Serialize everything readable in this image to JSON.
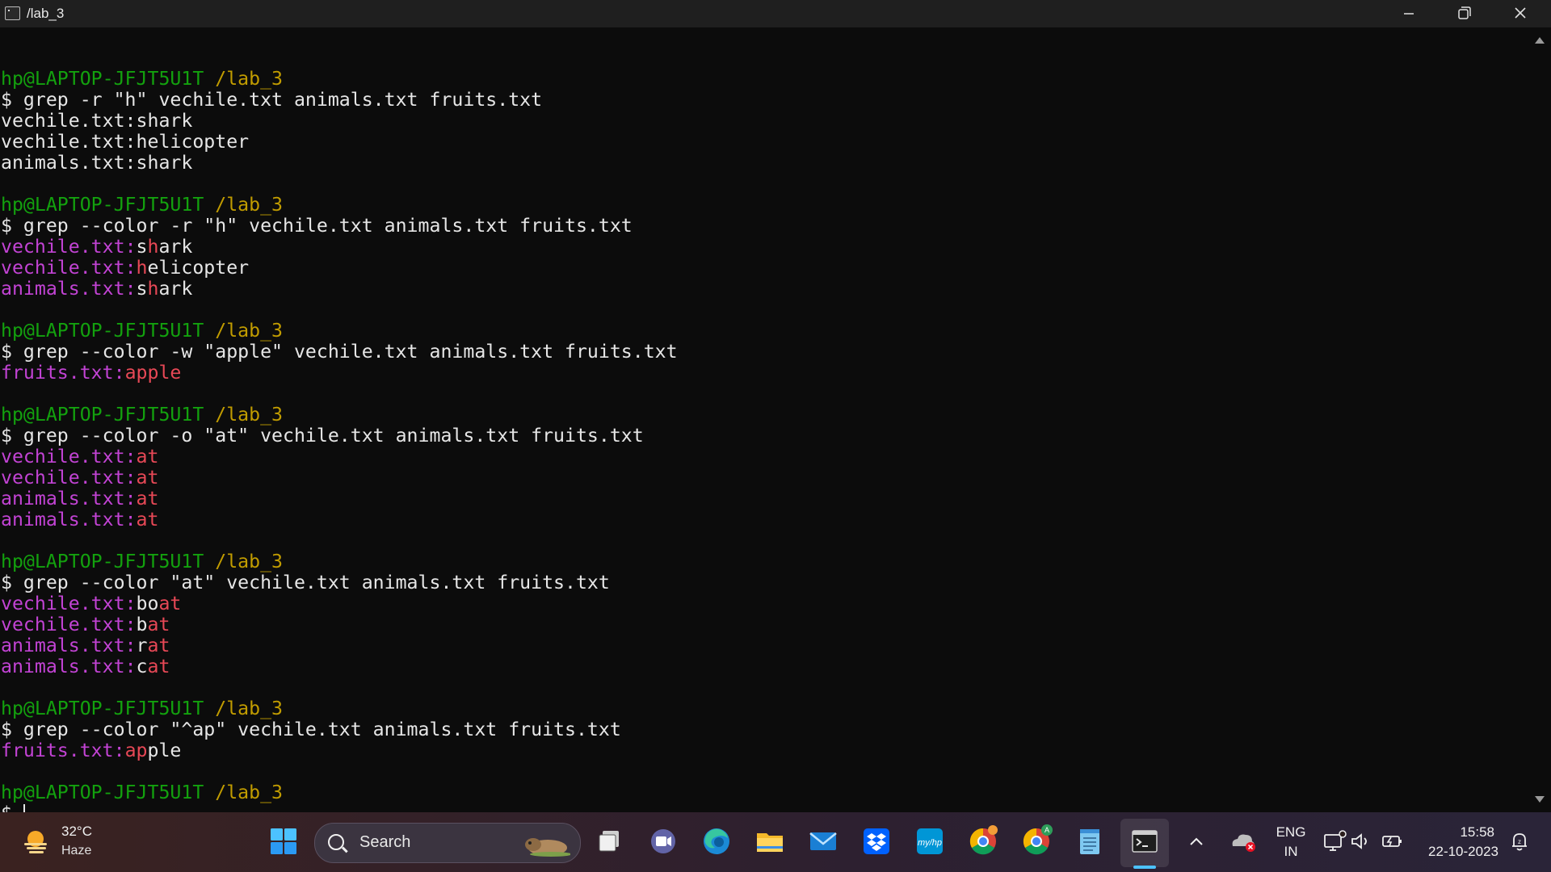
{
  "window": {
    "title": "/lab_3"
  },
  "terminal": {
    "lines": [
      [],
      [
        {
          "t": "hp@LAPTOP-JFJT5U1T",
          "c": "g"
        },
        {
          "t": " ",
          "c": "w"
        },
        {
          "t": "/lab_3",
          "c": "y"
        }
      ],
      [
        {
          "t": "$ grep -r \"h\" vechile.txt animals.txt fruits.txt",
          "c": "w"
        }
      ],
      [
        {
          "t": "vechile.txt:shark",
          "c": "w"
        }
      ],
      [
        {
          "t": "vechile.txt:helicopter",
          "c": "w"
        }
      ],
      [
        {
          "t": "animals.txt:shark",
          "c": "w"
        }
      ],
      [],
      [
        {
          "t": "hp@LAPTOP-JFJT5U1T",
          "c": "g"
        },
        {
          "t": " ",
          "c": "w"
        },
        {
          "t": "/lab_3",
          "c": "y"
        }
      ],
      [
        {
          "t": "$ grep --color -r \"h\" vechile.txt animals.txt fruits.txt",
          "c": "w"
        }
      ],
      [
        {
          "t": "vechile.txt",
          "c": "m"
        },
        {
          "t": ":",
          "c": "m"
        },
        {
          "t": "s",
          "c": "w"
        },
        {
          "t": "h",
          "c": "r"
        },
        {
          "t": "ark",
          "c": "w"
        }
      ],
      [
        {
          "t": "vechile.txt",
          "c": "m"
        },
        {
          "t": ":",
          "c": "m"
        },
        {
          "t": "h",
          "c": "r"
        },
        {
          "t": "elicopter",
          "c": "w"
        }
      ],
      [
        {
          "t": "animals.txt",
          "c": "m"
        },
        {
          "t": ":",
          "c": "m"
        },
        {
          "t": "s",
          "c": "w"
        },
        {
          "t": "h",
          "c": "r"
        },
        {
          "t": "ark",
          "c": "w"
        }
      ],
      [],
      [
        {
          "t": "hp@LAPTOP-JFJT5U1T",
          "c": "g"
        },
        {
          "t": " ",
          "c": "w"
        },
        {
          "t": "/lab_3",
          "c": "y"
        }
      ],
      [
        {
          "t": "$ grep --color -w \"apple\" vechile.txt animals.txt fruits.txt",
          "c": "w"
        }
      ],
      [
        {
          "t": "fruits.txt",
          "c": "m"
        },
        {
          "t": ":",
          "c": "m"
        },
        {
          "t": "apple",
          "c": "r"
        }
      ],
      [],
      [
        {
          "t": "hp@LAPTOP-JFJT5U1T",
          "c": "g"
        },
        {
          "t": " ",
          "c": "w"
        },
        {
          "t": "/lab_3",
          "c": "y"
        }
      ],
      [
        {
          "t": "$ grep --color -o \"at\" vechile.txt animals.txt fruits.txt",
          "c": "w"
        }
      ],
      [
        {
          "t": "vechile.txt",
          "c": "m"
        },
        {
          "t": ":",
          "c": "m"
        },
        {
          "t": "at",
          "c": "r"
        }
      ],
      [
        {
          "t": "vechile.txt",
          "c": "m"
        },
        {
          "t": ":",
          "c": "m"
        },
        {
          "t": "at",
          "c": "r"
        }
      ],
      [
        {
          "t": "animals.txt",
          "c": "m"
        },
        {
          "t": ":",
          "c": "m"
        },
        {
          "t": "at",
          "c": "r"
        }
      ],
      [
        {
          "t": "animals.txt",
          "c": "m"
        },
        {
          "t": ":",
          "c": "m"
        },
        {
          "t": "at",
          "c": "r"
        }
      ],
      [],
      [
        {
          "t": "hp@LAPTOP-JFJT5U1T",
          "c": "g"
        },
        {
          "t": " ",
          "c": "w"
        },
        {
          "t": "/lab_3",
          "c": "y"
        }
      ],
      [
        {
          "t": "$ grep --color \"at\" vechile.txt animals.txt fruits.txt",
          "c": "w"
        }
      ],
      [
        {
          "t": "vechile.txt",
          "c": "m"
        },
        {
          "t": ":",
          "c": "m"
        },
        {
          "t": "bo",
          "c": "w"
        },
        {
          "t": "at",
          "c": "r"
        }
      ],
      [
        {
          "t": "vechile.txt",
          "c": "m"
        },
        {
          "t": ":",
          "c": "m"
        },
        {
          "t": "b",
          "c": "w"
        },
        {
          "t": "at",
          "c": "r"
        }
      ],
      [
        {
          "t": "animals.txt",
          "c": "m"
        },
        {
          "t": ":",
          "c": "m"
        },
        {
          "t": "r",
          "c": "w"
        },
        {
          "t": "at",
          "c": "r"
        }
      ],
      [
        {
          "t": "animals.txt",
          "c": "m"
        },
        {
          "t": ":",
          "c": "m"
        },
        {
          "t": "c",
          "c": "w"
        },
        {
          "t": "at",
          "c": "r"
        }
      ],
      [],
      [
        {
          "t": "hp@LAPTOP-JFJT5U1T",
          "c": "g"
        },
        {
          "t": " ",
          "c": "w"
        },
        {
          "t": "/lab_3",
          "c": "y"
        }
      ],
      [
        {
          "t": "$ grep --color \"^ap\" vechile.txt animals.txt fruits.txt",
          "c": "w"
        }
      ],
      [
        {
          "t": "fruits.txt",
          "c": "m"
        },
        {
          "t": ":",
          "c": "m"
        },
        {
          "t": "ap",
          "c": "r"
        },
        {
          "t": "ple",
          "c": "w"
        }
      ],
      [],
      [
        {
          "t": "hp@LAPTOP-JFJT5U1T",
          "c": "g"
        },
        {
          "t": " ",
          "c": "w"
        },
        {
          "t": "/lab_3",
          "c": "y"
        }
      ],
      [
        {
          "t": "$ ",
          "c": "w"
        },
        {
          "t": "",
          "c": "cursor"
        }
      ]
    ]
  },
  "colors": {
    "prompt_user": "#13a10e",
    "prompt_path": "#c19c00",
    "filename": "#c243d4",
    "match": "#e74856",
    "text": "#e6e6e6",
    "background": "#0c0c0c"
  },
  "taskbar": {
    "weather": {
      "temp": "32°C",
      "condition": "Haze"
    },
    "search_label": "Search",
    "apps": [
      "start-icon",
      "task-view-icon",
      "meet-icon",
      "edge-icon",
      "file-explorer-icon",
      "mail-icon",
      "dropbox-icon",
      "myhp-icon",
      "chrome-icon",
      "chrome-profile-icon",
      "notepad-icon",
      "terminal-icon"
    ],
    "tray": {
      "language": "ENG",
      "region": "IN",
      "time": "15:58",
      "date": "22-10-2023"
    }
  }
}
